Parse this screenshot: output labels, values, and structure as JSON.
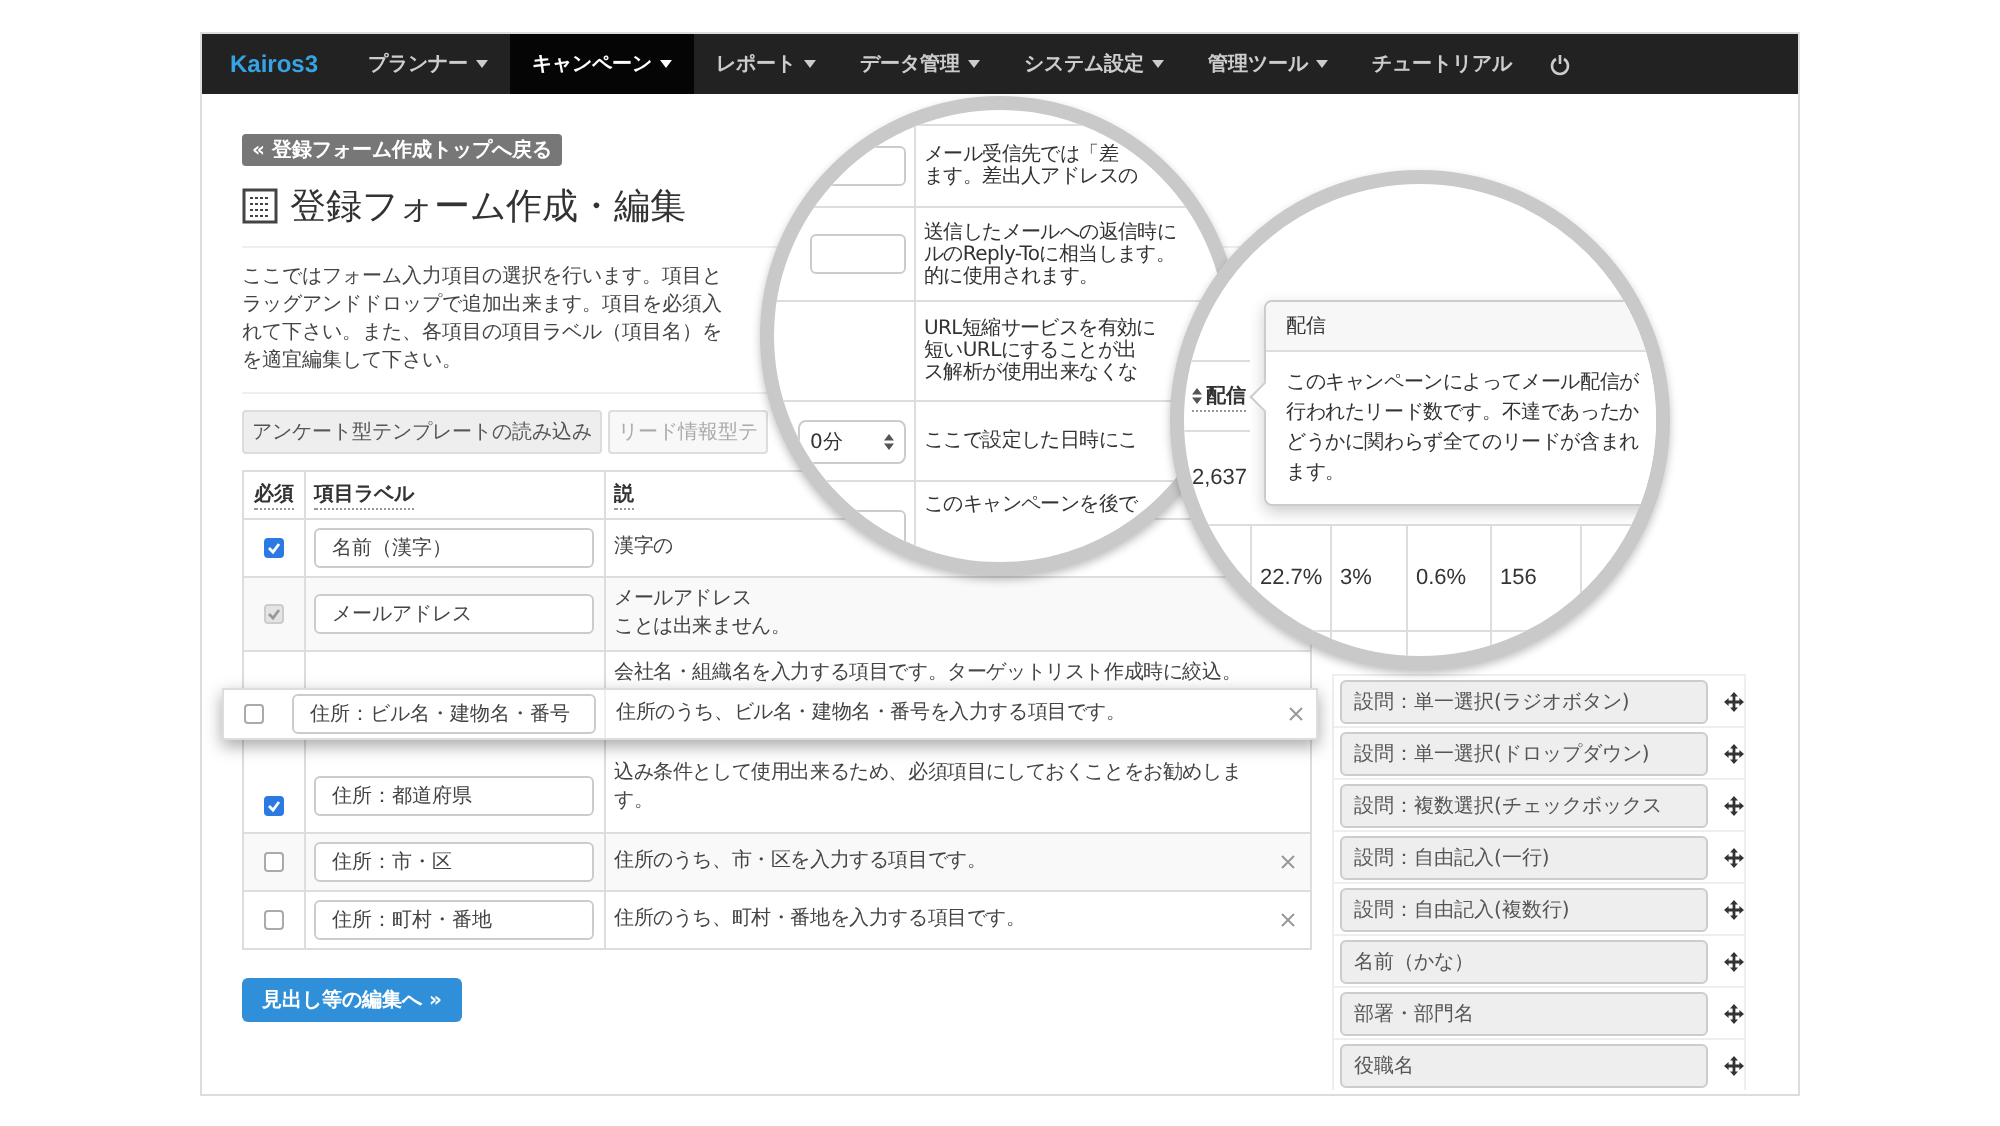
{
  "nav": {
    "brand": "Kairos3",
    "items": [
      {
        "label": "プランナー",
        "dropdown": true,
        "selected": false
      },
      {
        "label": "キャンペーン",
        "dropdown": true,
        "selected": true
      },
      {
        "label": "レポート",
        "dropdown": true,
        "selected": false
      },
      {
        "label": "データ管理",
        "dropdown": true,
        "selected": false
      },
      {
        "label": "システム設定",
        "dropdown": true,
        "selected": false
      },
      {
        "label": "管理ツール",
        "dropdown": true,
        "selected": false
      },
      {
        "label": "チュートリアル",
        "dropdown": false,
        "selected": false
      }
    ]
  },
  "back_button": "« 登録フォーム作成トップへ戻る",
  "title": "登録フォーム作成・編集",
  "description": [
    "ここではフォーム入力項目の選択を行います。項目と",
    "ラッグアンドドロップで追加出来ます。項目を必須入",
    "れて下さい。また、各項目の項目ラベル（項目名）を",
    "を適宜編集して下さい。"
  ],
  "template_buttons": [
    {
      "label": "アンケート型テンプレートの読み込み",
      "disabled": false
    },
    {
      "label": "リード情報型テ",
      "disabled": true
    }
  ],
  "table": {
    "columns": [
      "必須",
      "項目ラベル",
      "説"
    ],
    "rows": [
      {
        "checked": true,
        "disabled": false,
        "label": "名前（漢字）",
        "description": [
          "漢字の"
        ],
        "removable": false
      },
      {
        "checked": true,
        "disabled": true,
        "label": "メールアドレス",
        "description": [
          "メールアドレス",
          "ことは出来ません。"
        ],
        "removable": false
      },
      {
        "checked": true,
        "disabled": false,
        "label": "住所：都道府県",
        "description": [
          "会社名・組織名を入力する項目です。ターゲットリスト作成時に絞込。",
          "込み条件として使用出来るため、必須項目にしておくことをお勧めしま",
          "す。"
        ],
        "removable": false
      },
      {
        "checked": false,
        "disabled": false,
        "label": "住所：市・区",
        "description": [
          "住所のうち、市・区を入力する項目です。"
        ],
        "removable": true
      },
      {
        "checked": false,
        "disabled": false,
        "label": "住所：町村・番地",
        "description": [
          "住所のうち、町村・番地を入力する項目です。"
        ],
        "removable": true
      }
    ]
  },
  "dragged_row": {
    "checked": false,
    "label": "住所：ビル名・建物名・番号",
    "description": "住所のうち、ビル名・建物名・番号を入力する項目です。"
  },
  "next_button": "見出し等の編集へ »",
  "palette": [
    "設問：単一選択(ラジオボタン)",
    "設問：単一選択(ドロップダウン)",
    "設問：複数選択(チェックボックス",
    "設問：自由記入(一行)",
    "設問：自由記入(複数行)",
    "名前（かな）",
    "部署・部門名",
    "役職名"
  ],
  "magnifier_settings": {
    "rows": [
      {
        "kind": "input",
        "text": [
          "メール受信先では「差",
          "ます。差出人アドレスの"
        ]
      },
      {
        "kind": "input",
        "text": [
          "送信したメールへの返信時に",
          "ルのReply-Toに相当します。",
          "的に使用されます。"
        ]
      },
      {
        "kind": "none",
        "text": [
          "URL短縮サービスを有効に",
          "短いURLにすることが出",
          "ス解析が使用出来なくな"
        ]
      },
      {
        "kind": "select",
        "value": "0分",
        "text": [
          "ここで設定した日時にこ"
        ]
      },
      {
        "kind": "input",
        "text": [
          "このキャンペーンを後で"
        ]
      }
    ]
  },
  "magnifier_stats": {
    "header": "配信",
    "total": "2,637",
    "rates": [
      "22.7%",
      "3%",
      "0.6%",
      "156"
    ],
    "popover": {
      "title": "配信",
      "body": "このキャンペーンによってメール配信が行われたリード数です。不達であったかどうかに関わらず全てのリードが含まれます。"
    }
  }
}
